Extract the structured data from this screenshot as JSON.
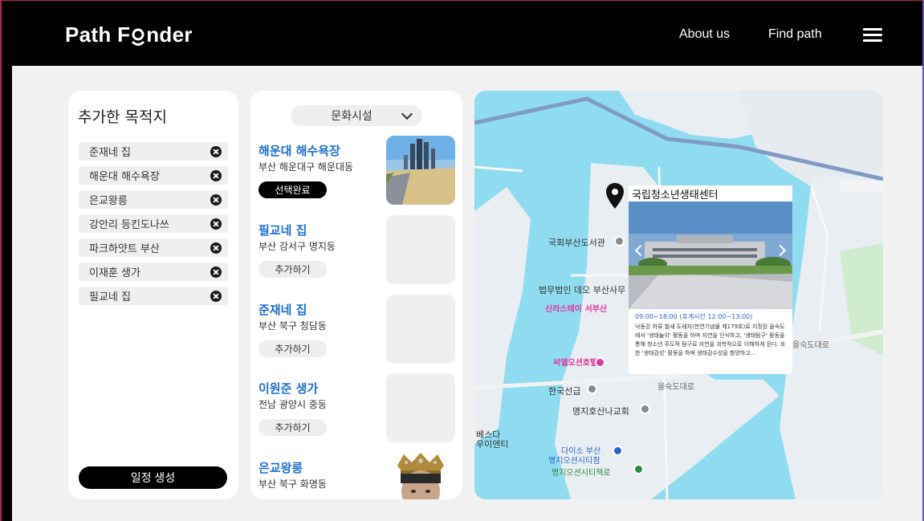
{
  "header": {
    "logo_text_before": "Path F",
    "logo_text_after": "nder",
    "nav_about": "About us",
    "nav_find": "Find path"
  },
  "destinations": {
    "title": "추가한 목적지",
    "items": [
      {
        "label": "준재네 집"
      },
      {
        "label": "해운대 해수욕장"
      },
      {
        "label": "은교왕릉"
      },
      {
        "label": "강안리 등킨도나쓰"
      },
      {
        "label": "파크하얏트 부산"
      },
      {
        "label": "이재훈 생가"
      },
      {
        "label": "필교네 집"
      }
    ],
    "schedule_button": "일정 생성"
  },
  "places": {
    "category": "문화시설",
    "items": [
      {
        "name": "해운대 해수욕장",
        "address": "부산 해운대구 해운대동",
        "button": "선택완료",
        "selected": true
      },
      {
        "name": "필교네 집",
        "address": "부산 강서구 명지동",
        "button": "추가하기",
        "selected": false
      },
      {
        "name": "준재네 집",
        "address": "부산 북구 청담동",
        "button": "추가하기",
        "selected": false
      },
      {
        "name": "이원준 생가",
        "address": "전남 광양시 중동",
        "button": "추가하기",
        "selected": false
      },
      {
        "name": "은교왕릉",
        "address": "부산 북구 화명동",
        "button": "",
        "selected": false
      }
    ]
  },
  "map": {
    "labels": {
      "library": "국회부산도서관",
      "law": "법무법인 데오 부산사무",
      "shinra": "신라스테이 서부산",
      "seaocean": "씨엘오션호텔",
      "koreaseongeup": "한국선급",
      "church": "명지호산나교회",
      "daiso": "다이소 부산",
      "daiso2": "명지오션시티점",
      "bookstore": "명지오션시티책로",
      "bestadent": "베스다",
      "bestadent2": "우이엔티",
      "road1": "을숙도대로",
      "road2": "을숙도대로"
    },
    "popup": {
      "title": "국립청소년생태센터",
      "hours": "09:00~18:00 (휴게시간 12:00~13:00)",
      "description": "낙동강 하류 철새 도래지(천연기념물 제179호)로 지정된 을숙도에서 '생태놀이' 활동을 하며 자연을 인식하고, '생태탐구' 활동을 통해 청소년 주도적 탐구로 자연을 과학적으로 이해하게 된다. 또한 '생태감성' 활동을 하며 생태감수성을 함양하고..."
    }
  }
}
